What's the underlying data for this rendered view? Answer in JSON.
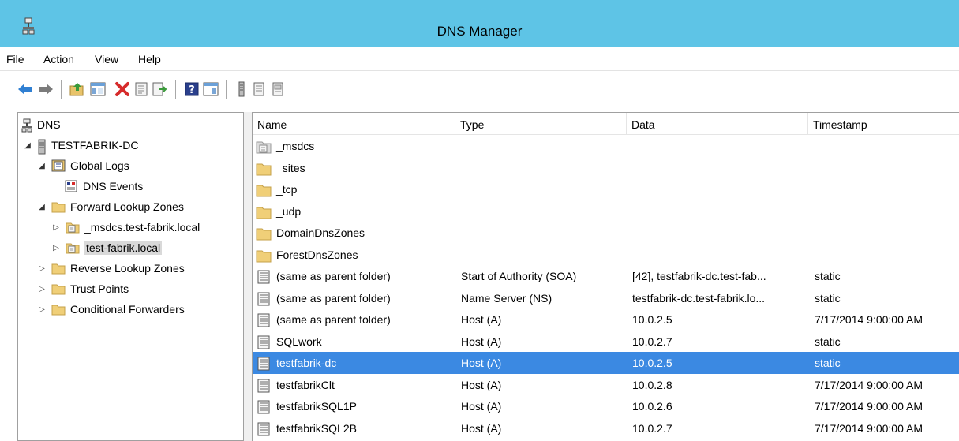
{
  "window": {
    "title": "DNS Manager"
  },
  "menu": [
    "File",
    "Action",
    "View",
    "Help"
  ],
  "toolbar": {
    "buttons": [
      "back-icon",
      "forward-icon",
      "up-folder-icon",
      "show-hide-tree-icon",
      "delete-icon",
      "properties-icon",
      "export-list-icon",
      "help-icon",
      "show-hide-action-icon",
      "new-host-icon",
      "new-alias-icon",
      "new-mail-exchanger-icon"
    ]
  },
  "tree": {
    "root": "DNS",
    "server": "TESTFABRIK-DC",
    "global_logs": "Global Logs",
    "dns_events": "DNS Events",
    "forward_zones": "Forward Lookup Zones",
    "msdcs_zone": "_msdcs.test-fabrik.local",
    "test_zone": "test-fabrik.local",
    "reverse_zones": "Reverse Lookup Zones",
    "trust_points": "Trust Points",
    "cond_forwarders": "Conditional Forwarders"
  },
  "list": {
    "columns": [
      "Name",
      "Type",
      "Data",
      "Timestamp"
    ],
    "rows": [
      {
        "name": "_msdcs",
        "type": "",
        "data": "",
        "timestamp": "",
        "icon": "delegated-folder-icon"
      },
      {
        "name": "_sites",
        "type": "",
        "data": "",
        "timestamp": "",
        "icon": "folder-icon"
      },
      {
        "name": "_tcp",
        "type": "",
        "data": "",
        "timestamp": "",
        "icon": "folder-icon"
      },
      {
        "name": "_udp",
        "type": "",
        "data": "",
        "timestamp": "",
        "icon": "folder-icon"
      },
      {
        "name": "DomainDnsZones",
        "type": "",
        "data": "",
        "timestamp": "",
        "icon": "folder-icon"
      },
      {
        "name": "ForestDnsZones",
        "type": "",
        "data": "",
        "timestamp": "",
        "icon": "folder-icon"
      },
      {
        "name": "(same as parent folder)",
        "type": "Start of Authority (SOA)",
        "data": "[42], testfabrik-dc.test-fab...",
        "timestamp": "static",
        "icon": "record-icon"
      },
      {
        "name": "(same as parent folder)",
        "type": "Name Server (NS)",
        "data": "testfabrik-dc.test-fabrik.lo...",
        "timestamp": "static",
        "icon": "record-icon"
      },
      {
        "name": "(same as parent folder)",
        "type": "Host (A)",
        "data": "10.0.2.5",
        "timestamp": "7/17/2014 9:00:00 AM",
        "icon": "record-icon"
      },
      {
        "name": "SQLwork",
        "type": "Host (A)",
        "data": "10.0.2.7",
        "timestamp": "static",
        "icon": "record-icon"
      },
      {
        "name": "testfabrik-dc",
        "type": "Host (A)",
        "data": "10.0.2.5",
        "timestamp": "static",
        "icon": "record-icon",
        "selected": true
      },
      {
        "name": "testfabrikClt",
        "type": "Host (A)",
        "data": "10.0.2.8",
        "timestamp": "7/17/2014 9:00:00 AM",
        "icon": "record-icon"
      },
      {
        "name": "testfabrikSQL1P",
        "type": "Host (A)",
        "data": "10.0.2.6",
        "timestamp": "7/17/2014 9:00:00 AM",
        "icon": "record-icon"
      },
      {
        "name": "testfabrikSQL2B",
        "type": "Host (A)",
        "data": "10.0.2.7",
        "timestamp": "7/17/2014 9:00:00 AM",
        "icon": "record-icon"
      }
    ]
  },
  "colors": {
    "titlebar": "#5ec4e6",
    "selection": "#3b89e2",
    "tree_selection": "#d9d9d9"
  }
}
